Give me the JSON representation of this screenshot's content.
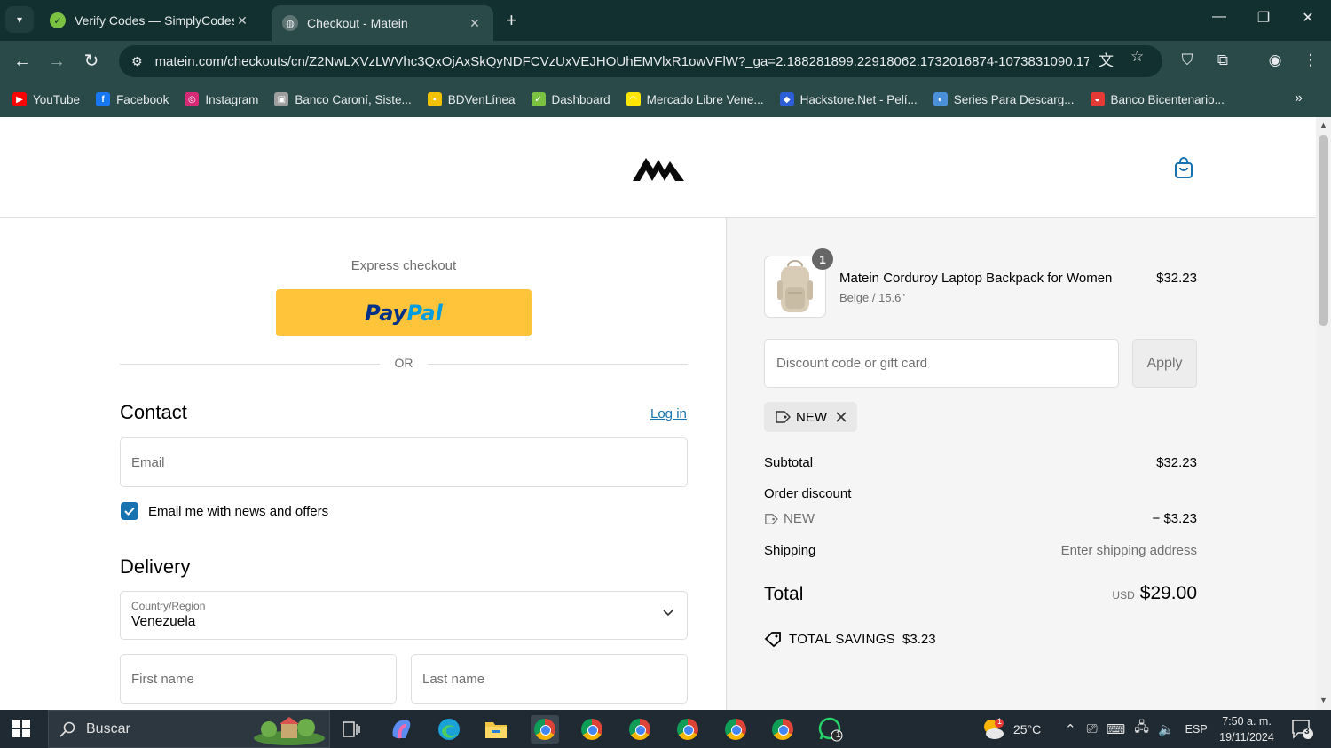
{
  "browser": {
    "tabs": [
      {
        "title": "Verify Codes — SimplyCodes",
        "active": false
      },
      {
        "title": "Checkout - Matein",
        "active": true
      }
    ],
    "url": "matein.com/checkouts/cn/Z2NwLXVzLWVhc3QxOjAxSkQyNDFCVzUxVEJHOUhEMVlxR1owVFlW?_ga=2.188281899.22918062.1732016874-1073831090.17...",
    "bookmarks": [
      {
        "label": "YouTube",
        "icon": "youtube-icon",
        "color": "#ff0000"
      },
      {
        "label": "Facebook",
        "icon": "facebook-icon",
        "color": "#1877f2"
      },
      {
        "label": "Instagram",
        "icon": "instagram-icon",
        "color": "#d62976"
      },
      {
        "label": "Banco Caroní, Siste...",
        "icon": "bank-icon",
        "color": "#9e9e9e"
      },
      {
        "label": "BDVenLínea",
        "icon": "bdv-icon",
        "color": "#f2c200"
      },
      {
        "label": "Dashboard",
        "icon": "dashboard-icon",
        "color": "#7cc242"
      },
      {
        "label": "Mercado Libre Vene...",
        "icon": "mercadolibre-icon",
        "color": "#ffe600"
      },
      {
        "label": "Hackstore.Net - Pelí...",
        "icon": "hackstore-icon",
        "color": "#2c5fd6"
      },
      {
        "label": "Series Para Descarg...",
        "icon": "series-icon",
        "color": "#4a90d9"
      },
      {
        "label": "Banco Bicentenario...",
        "icon": "bicentenario-icon",
        "color": "#e53935"
      }
    ]
  },
  "checkout": {
    "express_label": "Express checkout",
    "paypal_part1": "Pay",
    "paypal_part2": "Pal",
    "or_label": "OR",
    "contact_title": "Contact",
    "login_label": "Log in",
    "email_placeholder": "Email",
    "newsletter_label": "Email me with news and offers",
    "newsletter_checked": true,
    "delivery_title": "Delivery",
    "country_label": "Country/Region",
    "country_value": "Venezuela",
    "first_name_placeholder": "First name",
    "last_name_placeholder": "Last name"
  },
  "summary": {
    "product": {
      "name": "Matein Corduroy Laptop Backpack for Women",
      "variant": "Beige / 15.6\"",
      "price": "$32.23",
      "quantity": "1"
    },
    "discount_placeholder": "Discount code or gift card",
    "apply_label": "Apply",
    "applied_code": "NEW",
    "subtotal_label": "Subtotal",
    "subtotal_value": "$32.23",
    "order_discount_label": "Order discount",
    "discount_code": "NEW",
    "discount_value": "− $3.23",
    "shipping_label": "Shipping",
    "shipping_value": "Enter shipping address",
    "total_label": "Total",
    "total_currency": "USD",
    "total_value": "$29.00",
    "savings_label": "TOTAL SAVINGS",
    "savings_value": "$3.23"
  },
  "taskbar": {
    "search_label": "Buscar",
    "weather": "25°C",
    "language": "ESP",
    "time": "7:50 a. m.",
    "date": "19/11/2024",
    "notification_count": "3",
    "whatsapp_badge": "1",
    "weather_badge": "1"
  },
  "colors": {
    "chrome_dark": "#12302f",
    "chrome_toolbar": "#2a4a49",
    "paypal_yellow": "#ffc439",
    "link_blue": "#1773b0",
    "summary_bg": "#f5f5f5"
  }
}
